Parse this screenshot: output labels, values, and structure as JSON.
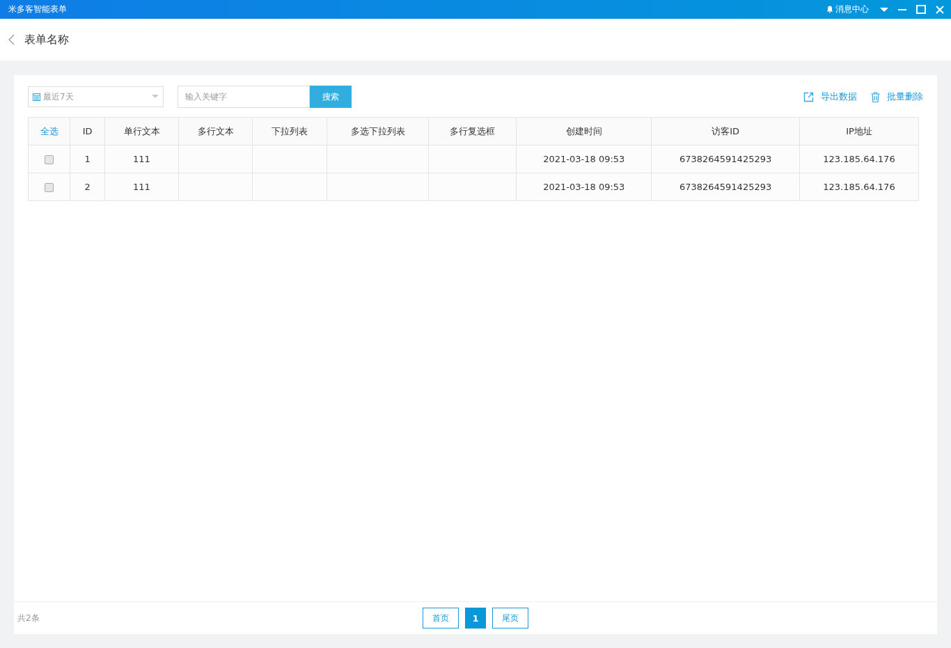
{
  "window": {
    "title": "米多客智能表单",
    "message_center": "消息中心"
  },
  "page": {
    "title": "表单名称"
  },
  "toolbar": {
    "date_range": "最近7天",
    "search": {
      "placeholder": "输入关键字"
    },
    "search_button": "搜索",
    "export": "导出数据",
    "batch_delete": "批量删除"
  },
  "table": {
    "select_all": "全选",
    "columns": [
      "ID",
      "单行文本",
      "多行文本",
      "下拉列表",
      "多选下拉列表",
      "多行复选框",
      "创建时间",
      "访客ID",
      "IP地址"
    ],
    "rows": [
      {
        "checked": false,
        "cells": [
          "1",
          "111",
          null,
          null,
          null,
          null,
          "2021-03-18 09:53",
          "6738264591425293",
          "123.185.64.176"
        ]
      },
      {
        "checked": false,
        "cells": [
          "2",
          "111",
          null,
          null,
          null,
          null,
          "2021-03-18 09:53",
          "6738264591425293",
          "123.185.64.176"
        ]
      }
    ]
  },
  "footer": {
    "total": "共2条",
    "first": "首页",
    "pages": [
      {
        "label": "1",
        "selected": true
      }
    ],
    "last": "尾页"
  }
}
